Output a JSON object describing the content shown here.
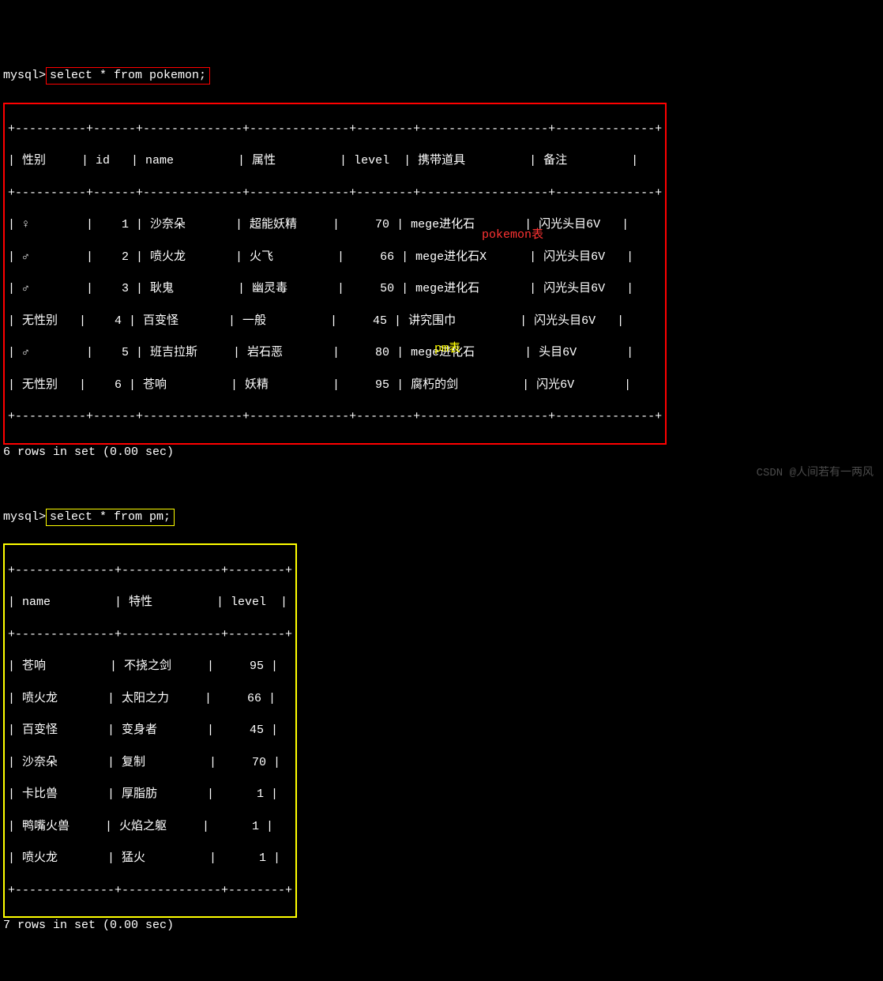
{
  "prompt": "mysql>",
  "query1": "select * from pokemon;",
  "query2": "select * from pm;",
  "table1": {
    "sep": "+----------+------+--------------+--------------+--------+------------------+--------------+",
    "header": "| 性别     | id   | name         | 属性         | level  | 携带道具         | 备注         |",
    "rows": [
      "| ♀        |    1 | 沙奈朵       | 超能妖精     |     70 | mege进化石       | 闪光头目6V   |",
      "| ♂        |    2 | 喷火龙       | 火飞         |     66 | mege进化石X      | 闪光头目6V   |",
      "| ♂        |    3 | 耿鬼         | 幽灵毒       |     50 | mege进化石       | 闪光头目6V   |",
      "| 无性别   |    4 | 百变怪       | 一般         |     45 | 讲究围巾         | 闪光头目6V   |",
      "| ♂        |    5 | 班吉拉斯     | 岩石恶       |     80 | mege进化石       | 头目6V       |",
      "| 无性别   |    6 | 苍响         | 妖精         |     95 | 腐朽的剑         | 闪光6V       |"
    ]
  },
  "result1": "6 rows in set (0.00 sec)",
  "table2": {
    "sep": "+--------------+--------------+--------+",
    "header": "| name         | 特性         | level  |",
    "rows": [
      "| 苍响         | 不挠之剑     |     95 |",
      "| 喷火龙       | 太阳之力     |     66 |",
      "| 百变怪       | 变身者       |     45 |",
      "| 沙奈朵       | 复制         |     70 |",
      "| 卡比兽       | 厚脂肪       |      1 |",
      "| 鸭嘴火兽     | 火焰之躯     |      1 |",
      "| 喷火龙       | 猛火         |      1 |"
    ]
  },
  "result2": "7 rows in set (0.00 sec)",
  "label1": "pokemon表",
  "label2": "pm表",
  "watermark": "CSDN @人间若有一两风"
}
